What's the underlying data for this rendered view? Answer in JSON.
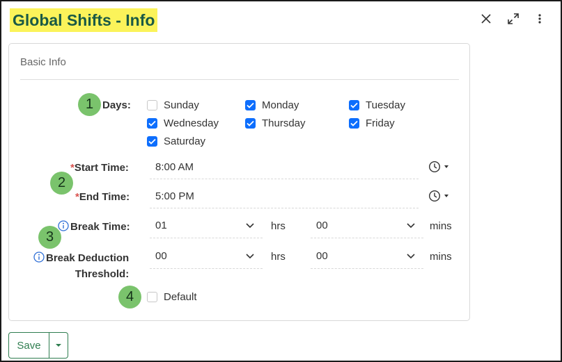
{
  "header": {
    "title": "Global Shifts - Info",
    "icons": [
      "close-icon",
      "expand-icon",
      "more-vertical-icon"
    ]
  },
  "card": {
    "section_title": "Basic Info"
  },
  "badges": [
    "1",
    "2",
    "3",
    "4"
  ],
  "days": {
    "label": "Days:",
    "items": [
      {
        "label": "Sunday",
        "checked": false
      },
      {
        "label": "Monday",
        "checked": true
      },
      {
        "label": "Tuesday",
        "checked": true
      },
      {
        "label": "Wednesday",
        "checked": true
      },
      {
        "label": "Thursday",
        "checked": true
      },
      {
        "label": "Friday",
        "checked": true
      },
      {
        "label": "Saturday",
        "checked": true
      }
    ]
  },
  "start_time": {
    "required": "*",
    "label": "Start Time:",
    "value": "8:00 AM"
  },
  "end_time": {
    "required": "*",
    "label": "End Time:",
    "value": "5:00 PM"
  },
  "break_time": {
    "label": "Break Time:",
    "hours": "01",
    "hours_unit": "hrs",
    "mins": "00",
    "mins_unit": "mins"
  },
  "break_threshold": {
    "label_line1": "Break Deduction",
    "label_line2": "Threshold:",
    "hours": "00",
    "hours_unit": "hrs",
    "mins": "00",
    "mins_unit": "mins"
  },
  "default_option": {
    "label": "Default",
    "checked": false
  },
  "footer": {
    "save_label": "Save"
  },
  "colors": {
    "accent": "#0d6efd",
    "badge": "#7ac36c",
    "title_highlight": "#fbf35a",
    "title_text": "#1a5a45",
    "save_border": "#2e7d4f",
    "required": "#d9534f"
  }
}
